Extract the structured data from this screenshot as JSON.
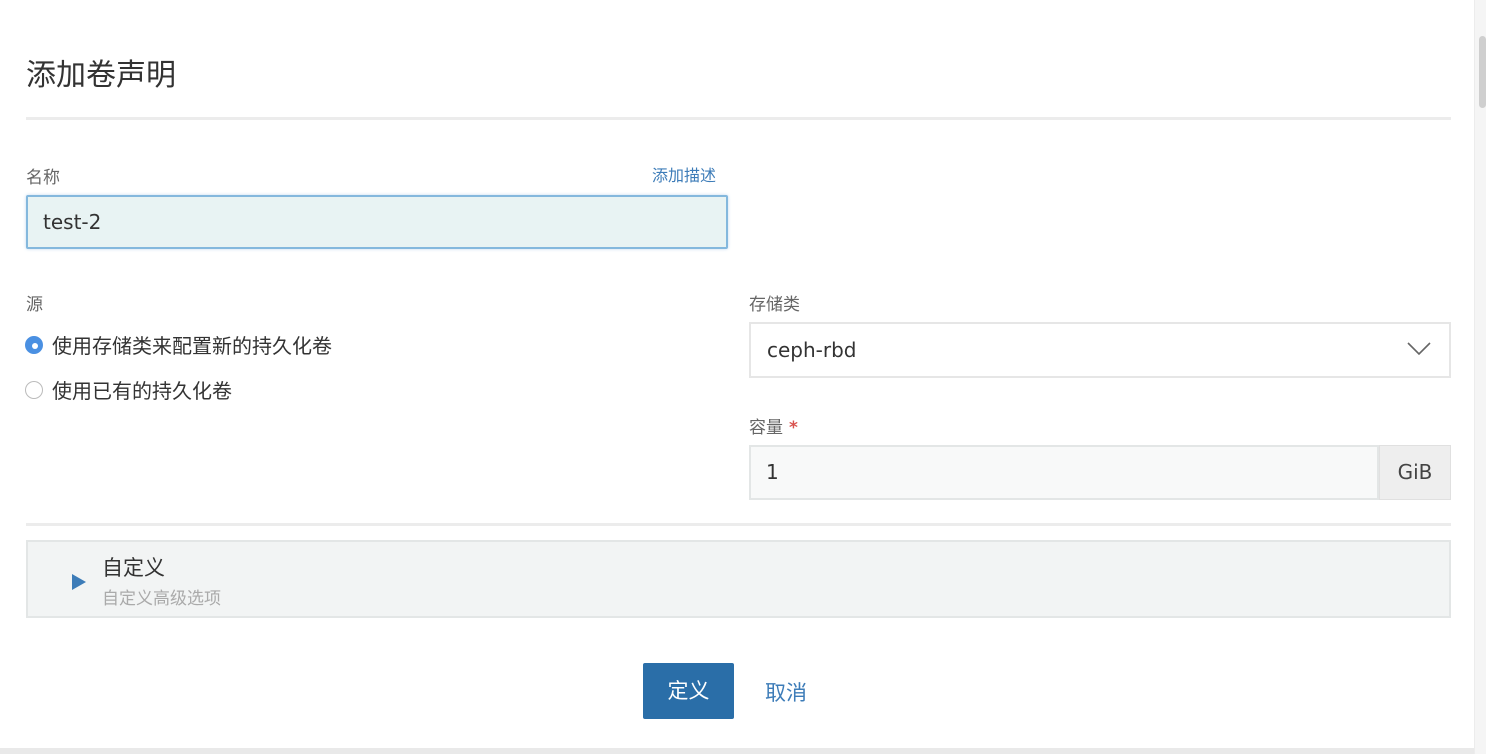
{
  "page": {
    "title": "添加卷声明"
  },
  "name_field": {
    "label": "名称",
    "add_description_link": "添加描述",
    "value": "test-2"
  },
  "source": {
    "label": "源",
    "options": [
      {
        "label": "使用存储类来配置新的持久化卷",
        "selected": true
      },
      {
        "label": "使用已有的持久化卷",
        "selected": false
      }
    ]
  },
  "storage_class": {
    "label": "存储类",
    "selected": "ceph-rbd",
    "icon": "chevron-down-icon"
  },
  "capacity": {
    "label": "容量",
    "required_mark": "*",
    "value": "1",
    "unit": "GiB"
  },
  "customize": {
    "title": "自定义",
    "subtitle": "自定义高级选项",
    "icon": "expand-triangle-icon"
  },
  "actions": {
    "submit_label": "定义",
    "cancel_label": "取消"
  },
  "colors": {
    "accent": "#2a6ea8",
    "link": "#3d7cb8",
    "required": "#d9534f"
  }
}
